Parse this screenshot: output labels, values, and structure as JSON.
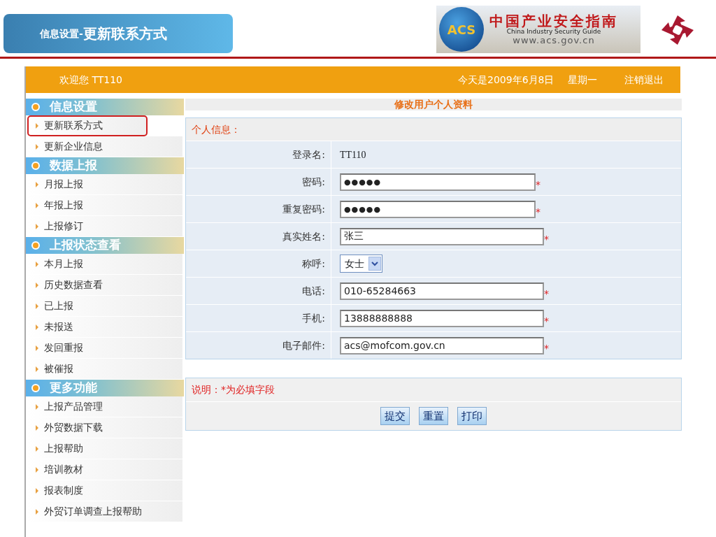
{
  "slide_title": {
    "prefix": "信息设置-",
    "main": "更新联系方式"
  },
  "banner": {
    "emblem": "ACS",
    "title": "中国产业安全指南",
    "subtitle": "China  Industry  Security  Guide",
    "url": "www.acs.gov.cn"
  },
  "topbar": {
    "welcome": "欢迎您  TT110",
    "date": "今天是2009年6月8日",
    "weekday": "星期一",
    "logout": "注销退出"
  },
  "sidebar": [
    {
      "title": "信息设置",
      "items": [
        {
          "label": "更新联系方式",
          "selected": true
        },
        {
          "label": "更新企业信息",
          "selected": false
        }
      ]
    },
    {
      "title": "数据上报",
      "items": [
        {
          "label": "月报上报",
          "selected": false
        },
        {
          "label": "年报上报",
          "selected": false
        },
        {
          "label": "上报修订",
          "selected": false
        }
      ]
    },
    {
      "title": "上报状态查看",
      "items": [
        {
          "label": "本月上报",
          "selected": false
        },
        {
          "label": "历史数据查看",
          "selected": false
        },
        {
          "label": "已上报",
          "selected": false
        },
        {
          "label": "未报送",
          "selected": false
        },
        {
          "label": "发回重报",
          "selected": false
        },
        {
          "label": "被催报",
          "selected": false
        }
      ]
    },
    {
      "title": "更多功能",
      "items": [
        {
          "label": "上报产品管理",
          "selected": false
        },
        {
          "label": "外贸数据下载",
          "selected": false
        },
        {
          "label": "上报帮助",
          "selected": false
        },
        {
          "label": "培训教材",
          "selected": false
        },
        {
          "label": "报表制度",
          "selected": false
        },
        {
          "label": "外贸订单调查上报帮助",
          "selected": false
        }
      ]
    }
  ],
  "form": {
    "title": "修改用户个人资料",
    "section": "个人信息：",
    "fields": [
      {
        "kind": "static",
        "label": "登录名:",
        "value": "TT110",
        "required": false
      },
      {
        "kind": "password",
        "label": "密码:",
        "value": "●●●●●",
        "required": true
      },
      {
        "kind": "password",
        "label": "重复密码:",
        "value": "●●●●●",
        "required": true
      },
      {
        "kind": "text",
        "label": "真实姓名:",
        "value": "张三",
        "required": true
      },
      {
        "kind": "select",
        "label": "称呼:",
        "value": "女士",
        "required": false
      },
      {
        "kind": "text",
        "label": "电话:",
        "value": "010-65284663",
        "required": true
      },
      {
        "kind": "text",
        "label": "手机:",
        "value": "13888888888",
        "required": true
      },
      {
        "kind": "text",
        "label": "电子邮件:",
        "value": "acs@mofcom.gov.cn",
        "required": true
      }
    ],
    "required_mark": "*",
    "note": "说明：*为必填字段",
    "buttons": [
      "提交",
      "重置",
      "打印"
    ]
  }
}
